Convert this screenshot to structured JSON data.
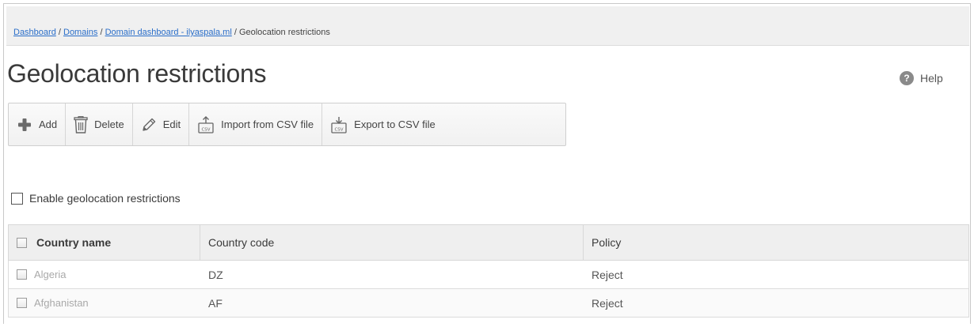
{
  "breadcrumb": {
    "items": [
      "Dashboard",
      "Domains",
      "Domain dashboard - ilyaspala.ml"
    ],
    "separator": " / ",
    "current": "Geolocation restrictions"
  },
  "page": {
    "title": "Geolocation restrictions"
  },
  "help": {
    "label": "Help",
    "icon": "help-icon"
  },
  "toolbar": {
    "add_label": "Add",
    "delete_label": "Delete",
    "edit_label": "Edit",
    "import_label": "Import from CSV file",
    "export_label": "Export to CSV file"
  },
  "enable": {
    "label": "Enable geolocation restrictions",
    "checked": false
  },
  "table": {
    "columns": [
      "Country name",
      "Country code",
      "Policy"
    ],
    "rows": [
      {
        "country": "Algeria",
        "code": "DZ",
        "policy": "Reject"
      },
      {
        "country": "Afghanistan",
        "code": "AF",
        "policy": "Reject"
      }
    ]
  },
  "colors": {
    "link": "#2a6ec9",
    "add_icon": "#6b6b6b",
    "header_bg": "#efefef"
  }
}
